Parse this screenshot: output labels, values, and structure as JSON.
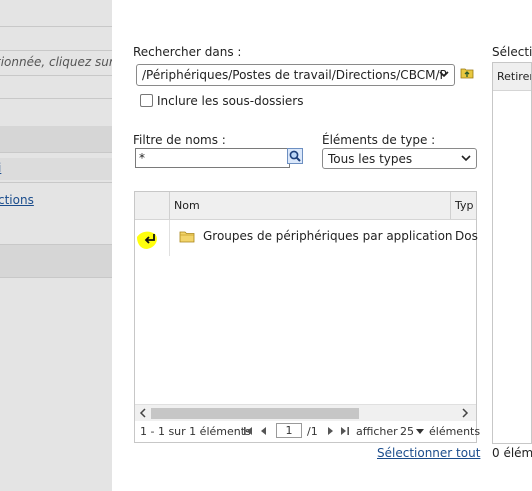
{
  "left_panel": {
    "hint_text": "tionnée, cliquez sur",
    "link_1": "i",
    "link_2": "ctions"
  },
  "search_in": {
    "label": "Rechercher dans :",
    "path": "/Périphériques/Postes de travail/Directions/CBCM/P",
    "up_icon": "folder-up-icon"
  },
  "include_subfolders": {
    "label": "Inclure les sous-dossiers",
    "checked": false
  },
  "name_filter": {
    "label": "Filtre de noms :",
    "value": "*",
    "search_icon": "magnifier-icon"
  },
  "type_filter": {
    "label": "Éléments de type :",
    "selected": "Tous les types"
  },
  "grid": {
    "columns": [
      "Nom",
      "Typ"
    ],
    "rows": [
      {
        "icon": "folder-icon",
        "name": "Groupes de périphériques par application",
        "type": "Dos"
      }
    ],
    "back_icon": "return-arrow-icon"
  },
  "pager": {
    "range_text": "1 - 1 sur 1 éléments",
    "page": "1",
    "of_pages": "/1",
    "show_label": "afficher",
    "page_size": "25",
    "items_label": "éléments"
  },
  "select_all_label": "Sélectionner tout",
  "selection_panel": {
    "title": "Sélectio",
    "column": "Retirer",
    "count_text": "0 élém"
  },
  "colors": {
    "link": "#1a4c8c",
    "highlight": "#ffff00"
  }
}
